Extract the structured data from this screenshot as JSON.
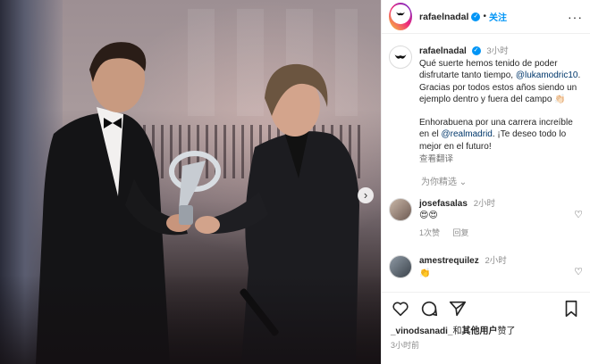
{
  "header": {
    "username": "rafaelnadal",
    "separator": "•",
    "follow_label": "关注",
    "more_icon": "more-horizontal-icon"
  },
  "caption": {
    "username": "rafaelnadal",
    "time": "3小时",
    "text_1": "Qué suerte hemos tenido de poder disfrutarte tanto tiempo, ",
    "mention_1": "@lukamodric10",
    "text_2": ". Gracias por todos estos años siendo un ejemplo dentro y fuera del campo 👏🏻",
    "text_3": "Enhorabuena por una carrera increíble en el ",
    "mention_2": "@realmadrid",
    "text_4": ". ¡Te deseo todo lo mejor en el futuro!",
    "translate_label": "查看翻译"
  },
  "tagged_label": "为你精选",
  "comments": [
    {
      "username": "josefasalas",
      "time": "2小时",
      "text": "😍😍",
      "likes_label": "1次赞",
      "reply_label": "回复"
    },
    {
      "username": "amestrequilez",
      "time": "2小时",
      "text": "👏"
    }
  ],
  "footer": {
    "liked_user": "_vinodsanadi_",
    "liked_mid": "和",
    "liked_others": "其他用户",
    "liked_end": "赞了",
    "post_time": "3小时前"
  },
  "colors": {
    "accent": "#0095f6",
    "link": "#00376b",
    "muted": "#8e8e8e"
  }
}
